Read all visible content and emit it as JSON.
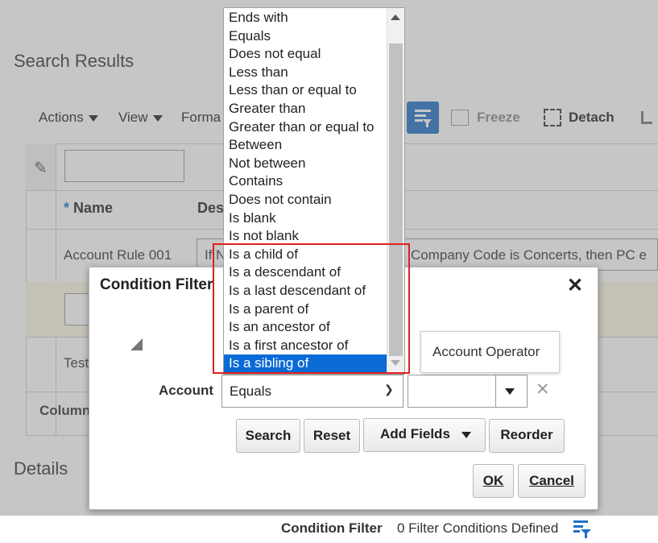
{
  "page": {
    "title": "Search Results",
    "details_title": "Details"
  },
  "toolbar": {
    "actions": "Actions",
    "view": "View",
    "format": "Forma",
    "freeze": "Freeze",
    "detach": "Detach"
  },
  "table": {
    "col_name": "Name",
    "col_desc": "Des",
    "row1_name": "Account Rule 001",
    "row1_desc_left": "If N",
    "row1_desc_right": "Company Code is Concerts, then PC e",
    "row3_name": "Test",
    "columns_label": "Column",
    "required_marker": "*"
  },
  "footer": {
    "condition_filter_label": "Condition Filter",
    "condition_filter_count": "0 Filter Conditions Defined"
  },
  "dialog": {
    "title": "Condition Filter",
    "account_label": "Account",
    "operator_value": "Equals",
    "value_input": "",
    "buttons": {
      "search": "Search",
      "reset": "Reset",
      "add_fields": "Add Fields",
      "reorder": "Reorder",
      "ok": "OK",
      "cancel": "Cancel"
    }
  },
  "operator_dropdown": {
    "options": [
      "Ends with",
      "Equals",
      "Does not equal",
      "Less than",
      "Less than or equal to",
      "Greater than",
      "Greater than or equal to",
      "Between",
      "Not between",
      "Contains",
      "Does not contain",
      "Is blank",
      "Is not blank",
      "Is a child of",
      "Is a descendant of",
      "Is a last descendant of",
      "Is a parent of",
      "Is an ancestor of",
      "Is a first ancestor of",
      "Is a sibling of"
    ],
    "selected": "Is a sibling of"
  },
  "tooltip": {
    "text": "Account Operator"
  },
  "colors": {
    "accent": "#0a6ad6",
    "highlight_box": "#e02020",
    "filter_button": "#1f6fc5"
  },
  "icons": {
    "edit": "pencil-icon",
    "filter": "filter-icon",
    "freeze": "freeze-icon",
    "detach": "detach-icon",
    "close": "close-icon",
    "clear": "clear-x-icon",
    "resize": "resize-corner-icon"
  }
}
